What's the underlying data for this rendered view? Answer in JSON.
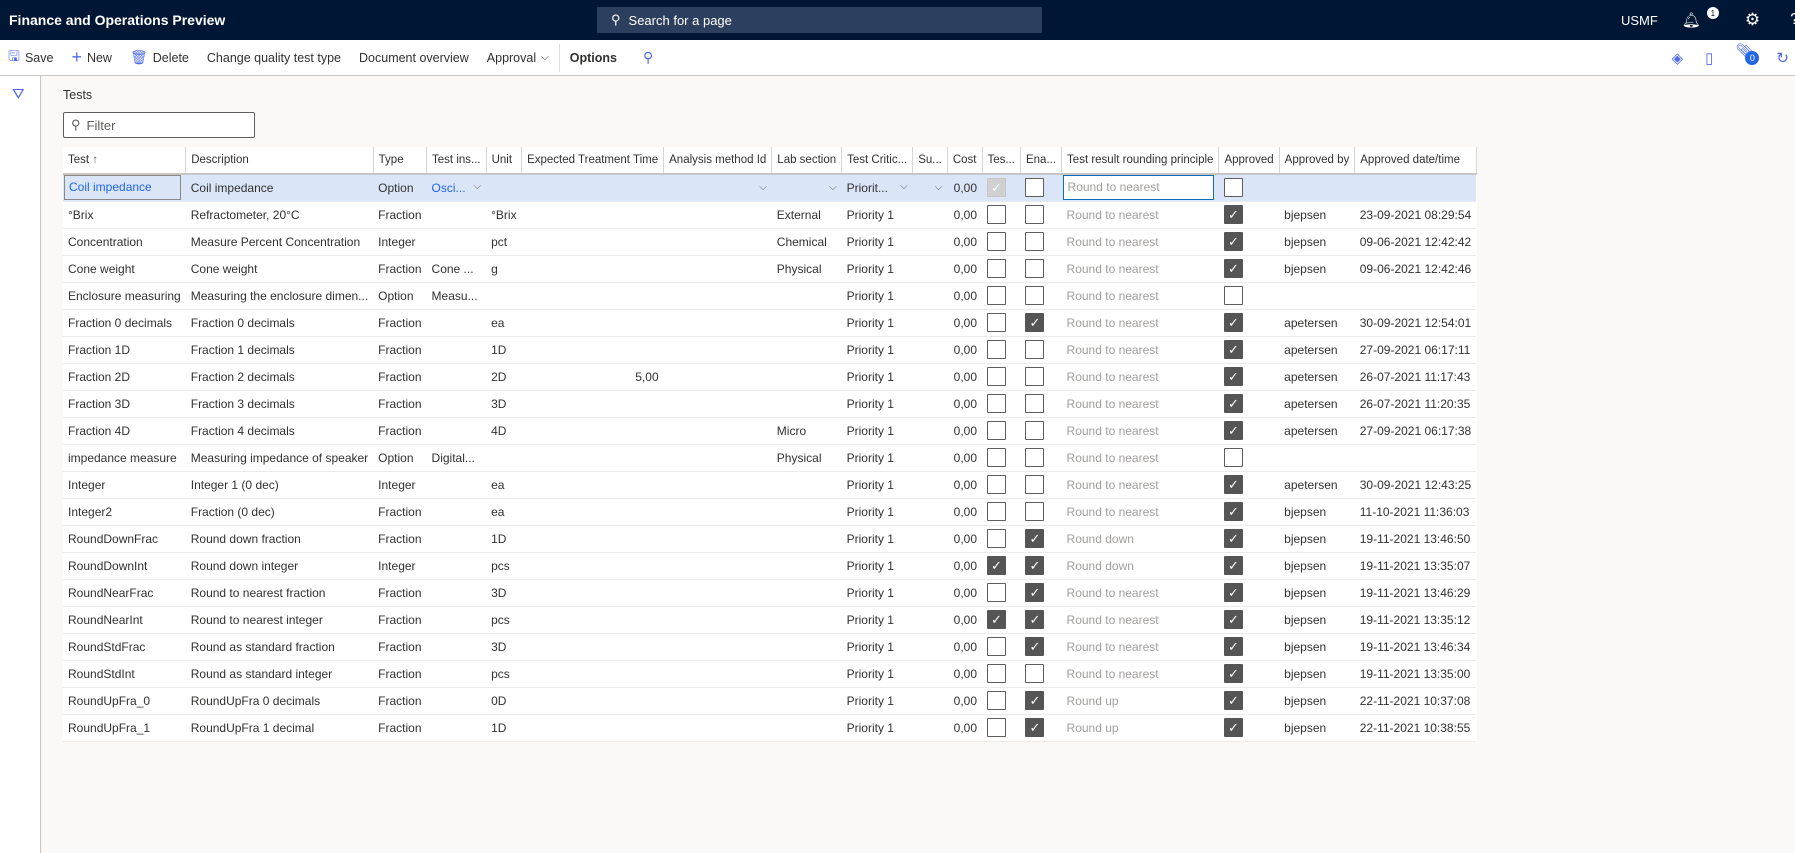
{
  "app_title": "Finance and Operations Preview",
  "search_placeholder": "Search for a page",
  "company": "USMF",
  "notifications_count": "1",
  "attachments_count": "0",
  "toolbar": {
    "save": "Save",
    "new": "New",
    "delete": "Delete",
    "change_type": "Change quality test type",
    "doc_overview": "Document overview",
    "approval": "Approval",
    "options": "Options"
  },
  "section_label": "Tests",
  "filter_placeholder": "Filter",
  "columns": [
    "Test",
    "Description",
    "Type",
    "Test ins...",
    "Unit",
    "Expected Treatment Time",
    "Analysis method Id",
    "Lab section",
    "Test Critic...",
    "Su...",
    "Cost",
    "Tes...",
    "Ena...",
    "Test result rounding principle",
    "Approved",
    "Approved by",
    "Approved date/time"
  ],
  "rows": [
    {
      "test": "Coil impedance",
      "desc": "Coil impedance",
      "type": "Option",
      "inst": "Osci...",
      "unit": "",
      "ett": "",
      "analysis": "",
      "lab": "",
      "crit": "Priorit...",
      "cost": "0,00",
      "tes": true,
      "ena": false,
      "round": "Round to nearest",
      "approved": false,
      "by": "",
      "date": ""
    },
    {
      "test": "°Brix",
      "desc": "Refractometer, 20°C",
      "type": "Fraction",
      "inst": "",
      "unit": "°Brix",
      "ett": "",
      "analysis": "",
      "lab": "External",
      "crit": "Priority 1",
      "cost": "0,00",
      "tes": false,
      "ena": false,
      "round": "Round to nearest",
      "approved": true,
      "by": "bjepsen",
      "date": "23-09-2021 08:29:54"
    },
    {
      "test": "Concentration",
      "desc": "Measure Percent Concentration",
      "type": "Integer",
      "inst": "",
      "unit": "pct",
      "ett": "",
      "analysis": "",
      "lab": "Chemical",
      "crit": "Priority 1",
      "cost": "0,00",
      "tes": false,
      "ena": false,
      "round": "Round to nearest",
      "approved": true,
      "by": "bjepsen",
      "date": "09-06-2021 12:42:42"
    },
    {
      "test": "Cone weight",
      "desc": "Cone weight",
      "type": "Fraction",
      "inst": "Cone ...",
      "unit": "g",
      "ett": "",
      "analysis": "",
      "lab": "Physical",
      "crit": "Priority 1",
      "cost": "0,00",
      "tes": false,
      "ena": false,
      "round": "Round to nearest",
      "approved": true,
      "by": "bjepsen",
      "date": "09-06-2021 12:42:46"
    },
    {
      "test": "Enclosure measuring",
      "desc": "Measuring the enclosure dimen...",
      "type": "Option",
      "inst": "Measu...",
      "unit": "",
      "ett": "",
      "analysis": "",
      "lab": "",
      "crit": "Priority 1",
      "cost": "0,00",
      "tes": false,
      "ena": false,
      "round": "Round to nearest",
      "approved": false,
      "by": "",
      "date": ""
    },
    {
      "test": "Fraction 0 decimals",
      "desc": "Fraction 0 decimals",
      "type": "Fraction",
      "inst": "",
      "unit": "ea",
      "ett": "",
      "analysis": "",
      "lab": "",
      "crit": "Priority 1",
      "cost": "0,00",
      "tes": false,
      "ena": true,
      "round": "Round to nearest",
      "approved": true,
      "by": "apetersen",
      "date": "30-09-2021 12:54:01"
    },
    {
      "test": "Fraction 1D",
      "desc": "Fraction 1 decimals",
      "type": "Fraction",
      "inst": "",
      "unit": "1D",
      "ett": "",
      "analysis": "",
      "lab": "",
      "crit": "Priority 1",
      "cost": "0,00",
      "tes": false,
      "ena": false,
      "round": "Round to nearest",
      "approved": true,
      "by": "apetersen",
      "date": "27-09-2021 06:17:11"
    },
    {
      "test": "Fraction 2D",
      "desc": "Fraction 2 decimals",
      "type": "Fraction",
      "inst": "",
      "unit": "2D",
      "ett": "5,00",
      "analysis": "",
      "lab": "",
      "crit": "Priority 1",
      "cost": "0,00",
      "tes": false,
      "ena": false,
      "round": "Round to nearest",
      "approved": true,
      "by": "apetersen",
      "date": "26-07-2021 11:17:43"
    },
    {
      "test": "Fraction 3D",
      "desc": "Fraction 3 decimals",
      "type": "Fraction",
      "inst": "",
      "unit": "3D",
      "ett": "",
      "analysis": "",
      "lab": "",
      "crit": "Priority 1",
      "cost": "0,00",
      "tes": false,
      "ena": false,
      "round": "Round to nearest",
      "approved": true,
      "by": "apetersen",
      "date": "26-07-2021 11:20:35"
    },
    {
      "test": "Fraction 4D",
      "desc": "Fraction 4 decimals",
      "type": "Fraction",
      "inst": "",
      "unit": "4D",
      "ett": "",
      "analysis": "",
      "lab": "Micro",
      "crit": "Priority 1",
      "cost": "0,00",
      "tes": false,
      "ena": false,
      "round": "Round to nearest",
      "approved": true,
      "by": "apetersen",
      "date": "27-09-2021 06:17:38"
    },
    {
      "test": "impedance measure",
      "desc": "Measuring impedance of speaker",
      "type": "Option",
      "inst": "Digital...",
      "unit": "",
      "ett": "",
      "analysis": "",
      "lab": "Physical",
      "crit": "Priority 1",
      "cost": "0,00",
      "tes": false,
      "ena": false,
      "round": "Round to nearest",
      "approved": false,
      "by": "",
      "date": ""
    },
    {
      "test": "Integer",
      "desc": "Integer 1 (0 dec)",
      "type": "Integer",
      "inst": "",
      "unit": "ea",
      "ett": "",
      "analysis": "",
      "lab": "",
      "crit": "Priority 1",
      "cost": "0,00",
      "tes": false,
      "ena": false,
      "round": "Round to nearest",
      "approved": true,
      "by": "apetersen",
      "date": "30-09-2021 12:43:25"
    },
    {
      "test": "Integer2",
      "desc": "Fraction (0 dec)",
      "type": "Fraction",
      "inst": "",
      "unit": "ea",
      "ett": "",
      "analysis": "",
      "lab": "",
      "crit": "Priority 1",
      "cost": "0,00",
      "tes": false,
      "ena": false,
      "round": "Round to nearest",
      "approved": true,
      "by": "bjepsen",
      "date": "11-10-2021 11:36:03"
    },
    {
      "test": "RoundDownFrac",
      "desc": "Round down fraction",
      "type": "Fraction",
      "inst": "",
      "unit": "1D",
      "ett": "",
      "analysis": "",
      "lab": "",
      "crit": "Priority 1",
      "cost": "0,00",
      "tes": false,
      "ena": true,
      "round": "Round down",
      "approved": true,
      "by": "bjepsen",
      "date": "19-11-2021 13:46:50"
    },
    {
      "test": "RoundDownInt",
      "desc": "Round down integer",
      "type": "Integer",
      "inst": "",
      "unit": "pcs",
      "ett": "",
      "analysis": "",
      "lab": "",
      "crit": "Priority 1",
      "cost": "0,00",
      "tes": true,
      "ena": true,
      "round": "Round down",
      "approved": true,
      "by": "bjepsen",
      "date": "19-11-2021 13:35:07"
    },
    {
      "test": "RoundNearFrac",
      "desc": "Round to nearest fraction",
      "type": "Fraction",
      "inst": "",
      "unit": "3D",
      "ett": "",
      "analysis": "",
      "lab": "",
      "crit": "Priority 1",
      "cost": "0,00",
      "tes": false,
      "ena": true,
      "round": "Round to nearest",
      "approved": true,
      "by": "bjepsen",
      "date": "19-11-2021 13:46:29"
    },
    {
      "test": "RoundNearInt",
      "desc": "Round to nearest integer",
      "type": "Fraction",
      "inst": "",
      "unit": "pcs",
      "ett": "",
      "analysis": "",
      "lab": "",
      "crit": "Priority 1",
      "cost": "0,00",
      "tes": true,
      "ena": true,
      "round": "Round to nearest",
      "approved": true,
      "by": "bjepsen",
      "date": "19-11-2021 13:35:12"
    },
    {
      "test": "RoundStdFrac",
      "desc": "Round as standard fraction",
      "type": "Fraction",
      "inst": "",
      "unit": "3D",
      "ett": "",
      "analysis": "",
      "lab": "",
      "crit": "Priority 1",
      "cost": "0,00",
      "tes": false,
      "ena": true,
      "round": "Round to nearest",
      "approved": true,
      "by": "bjepsen",
      "date": "19-11-2021 13:46:34"
    },
    {
      "test": "RoundStdInt",
      "desc": "Round as standard integer",
      "type": "Fraction",
      "inst": "",
      "unit": "pcs",
      "ett": "",
      "analysis": "",
      "lab": "",
      "crit": "Priority 1",
      "cost": "0,00",
      "tes": false,
      "ena": false,
      "round": "Round to nearest",
      "approved": true,
      "by": "bjepsen",
      "date": "19-11-2021 13:35:00"
    },
    {
      "test": "RoundUpFra_0",
      "desc": "RoundUpFra 0 decimals",
      "type": "Fraction",
      "inst": "",
      "unit": "0D",
      "ett": "",
      "analysis": "",
      "lab": "",
      "crit": "Priority 1",
      "cost": "0,00",
      "tes": false,
      "ena": true,
      "round": "Round up",
      "approved": true,
      "by": "bjepsen",
      "date": "22-11-2021 10:37:08"
    },
    {
      "test": "RoundUpFra_1",
      "desc": "RoundUpFra 1 decimal",
      "type": "Fraction",
      "inst": "",
      "unit": "1D",
      "ett": "",
      "analysis": "",
      "lab": "",
      "crit": "Priority 1",
      "cost": "0,00",
      "tes": false,
      "ena": true,
      "round": "Round up",
      "approved": true,
      "by": "bjepsen",
      "date": "22-11-2021 10:38:55"
    }
  ]
}
